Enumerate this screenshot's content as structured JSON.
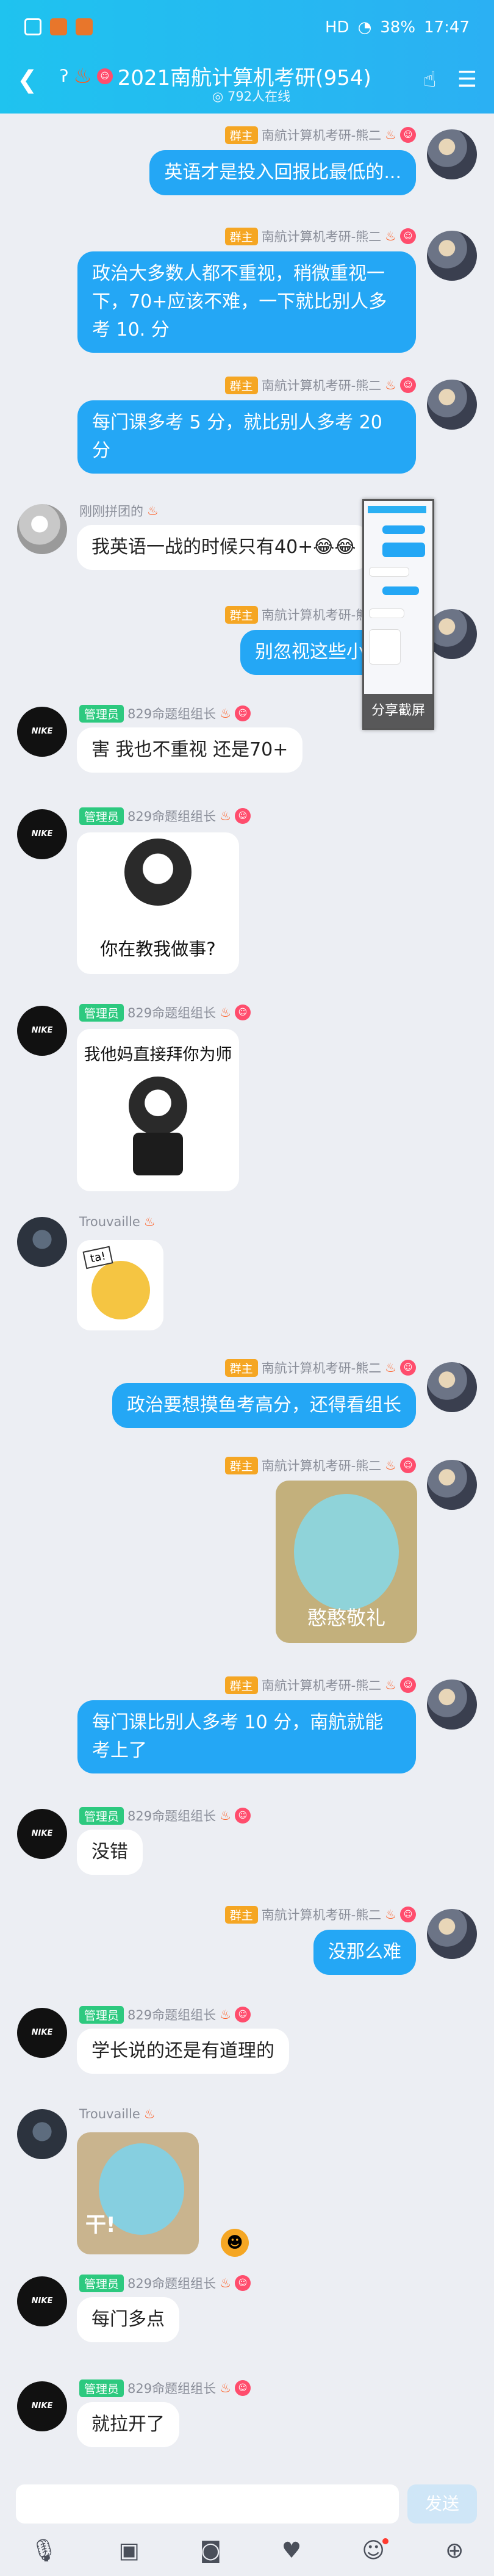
{
  "status": {
    "signal": "HD",
    "battery": "38%",
    "time": "17:47"
  },
  "header": {
    "title": "2021南航计算机考研(954)",
    "online": "792人在线"
  },
  "labels": {
    "owner": "群主",
    "admin": "管理员",
    "send": "发送",
    "share_screenshot": "分享截屏"
  },
  "names": {
    "owner": "南航计算机考研-熊二",
    "admin": "829命题组组长",
    "user1": "刚刚拼团的",
    "user2": "Trouvaille"
  },
  "avatars": {
    "nike": "NIKE"
  },
  "messages": {
    "m1": "英语才是投入回报比最低的...",
    "m2": "政治大多数人都不重视，稍微重视一下，70+应该不难，一下就比别人多考 10. 分",
    "m3": "每门课多考 5 分，就比别人多考 20 分",
    "m4": "我英语一战的时候只有40+😂😂",
    "m5": "别忽视这些小细节",
    "m6": "害 我也不重视 还是70+",
    "m7": "你在教我做事?",
    "m8": "我他妈直接拜你为师",
    "m10": "政治要想摸鱼考高分，还得看组长",
    "m11": "憨憨敬礼",
    "m12": "每门课比别人多考 10 分，南航就能考上了",
    "m13": "没错",
    "m14": "没那么难",
    "m15": "学长说的还是有道理的",
    "m16": "干!",
    "m17": "每门多点",
    "m18": "就拉开了",
    "ta": "ta!"
  },
  "colors": {
    "accent": "#24a7f5",
    "header": "#1fc3ef",
    "owner_badge": "#f5a623",
    "admin_badge": "#2dc97f"
  },
  "icons": [
    "back-icon",
    "ear-icon",
    "people-icon",
    "menu-icon",
    "voice-icon",
    "image-icon",
    "camera-icon",
    "gift-icon",
    "emoji-icon",
    "plus-icon"
  ]
}
